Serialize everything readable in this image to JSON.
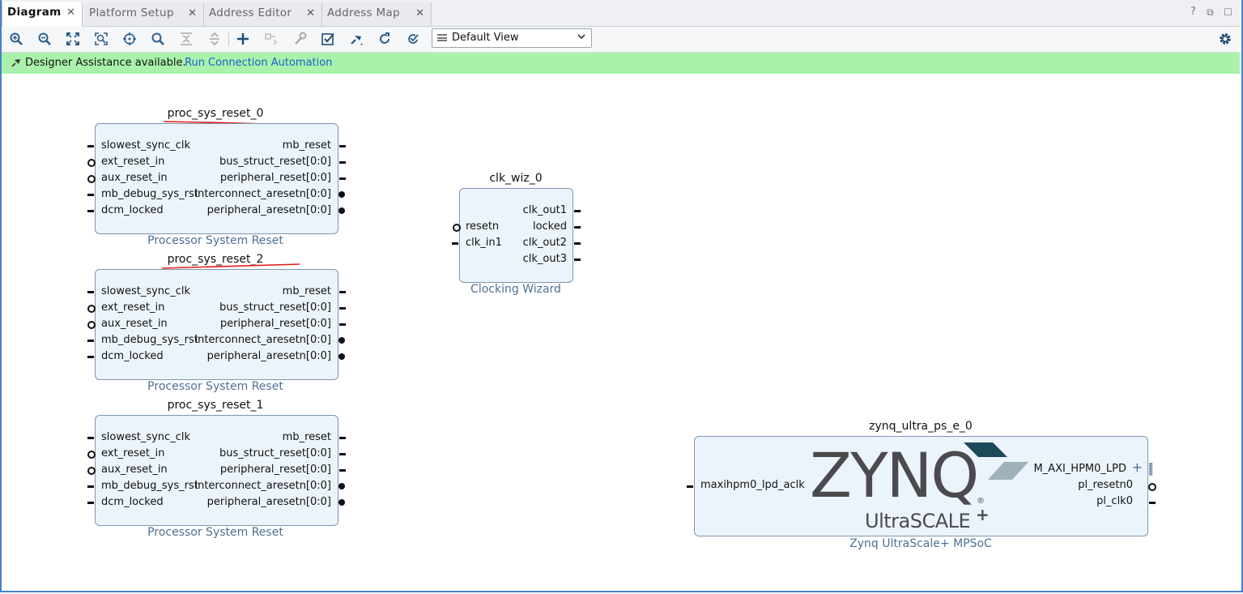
{
  "tabs": [
    {
      "label": "Diagram",
      "close": "✕"
    },
    {
      "label": "Platform Setup",
      "close": "✕"
    },
    {
      "label": "Address Editor",
      "close": "✕"
    },
    {
      "label": "Address Map",
      "close": "✕"
    }
  ],
  "window_controls": {
    "help": "?",
    "restore": "⧉",
    "maximize": "☐"
  },
  "toolbar": {
    "icons": [
      "zoom-in-icon",
      "zoom-out-icon",
      "fit-view-icon",
      "fit-selection-icon",
      "center-icon",
      "search-icon",
      "collapse-all-icon",
      "expand-all-icon",
      "add-ip-icon",
      "make-connection-icon",
      "properties-icon",
      "validate-design-icon",
      "pin-icon",
      "regenerate-layout-icon",
      "optimize-routing-icon",
      "settings-icon"
    ],
    "view_select": "Default View"
  },
  "banner": {
    "message": "Designer Assistance available.",
    "link": "Run Connection Automation",
    "color": "#aaf2ac"
  },
  "colors": {
    "block_fill": "#ecf4fb",
    "block_border": "#8095b0",
    "type_text": "#4f6f95",
    "annotation_red": "#e01c1c"
  },
  "blocks": {
    "reset0": {
      "instance": "proc_sys_reset_0",
      "type": "Processor System Reset",
      "inputs": [
        "slowest_sync_clk",
        "ext_reset_in",
        "aux_reset_in",
        "mb_debug_sys_rst",
        "dcm_locked"
      ],
      "outputs": [
        "mb_reset",
        "bus_struct_reset[0:0]",
        "peripheral_reset[0:0]",
        "interconnect_aresetn[0:0]",
        "peripheral_aresetn[0:0]"
      ]
    },
    "reset2": {
      "instance": "proc_sys_reset_2",
      "type": "Processor System Reset",
      "inputs": [
        "slowest_sync_clk",
        "ext_reset_in",
        "aux_reset_in",
        "mb_debug_sys_rst",
        "dcm_locked"
      ],
      "outputs": [
        "mb_reset",
        "bus_struct_reset[0:0]",
        "peripheral_reset[0:0]",
        "interconnect_aresetn[0:0]",
        "peripheral_aresetn[0:0]"
      ]
    },
    "reset1": {
      "instance": "proc_sys_reset_1",
      "type": "Processor System Reset",
      "inputs": [
        "slowest_sync_clk",
        "ext_reset_in",
        "aux_reset_in",
        "mb_debug_sys_rst",
        "dcm_locked"
      ],
      "outputs": [
        "mb_reset",
        "bus_struct_reset[0:0]",
        "peripheral_reset[0:0]",
        "interconnect_aresetn[0:0]",
        "peripheral_aresetn[0:0]"
      ]
    },
    "clkwiz": {
      "instance": "clk_wiz_0",
      "type": "Clocking Wizard",
      "inputs": [
        "resetn",
        "clk_in1"
      ],
      "outputs": [
        "clk_out1",
        "locked",
        "clk_out2",
        "clk_out3"
      ]
    },
    "zynq": {
      "instance": "zynq_ultra_ps_e_0",
      "type": "Zynq UltraScale+ MPSoC",
      "logo_main": "ZYNQ",
      "logo_reg": "®",
      "logo_sub": "UltraSCALE",
      "logo_plus": "+",
      "inputs": [
        "maxihpm0_lpd_aclk"
      ],
      "outputs": [
        "M_AXI_HPM0_LPD",
        "pl_resetn0",
        "pl_clk0"
      ],
      "expand": "+"
    }
  }
}
